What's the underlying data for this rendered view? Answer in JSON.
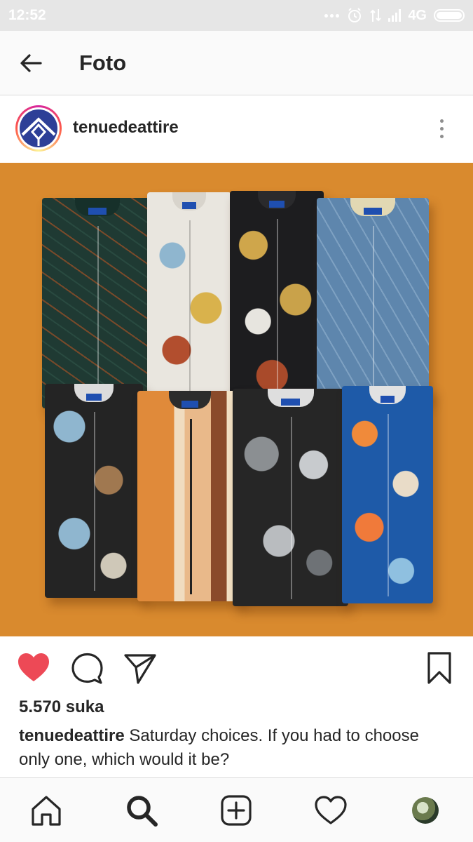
{
  "status_bar": {
    "time": "12:52",
    "network": "4G",
    "icons": [
      "notification-dots-icon",
      "alarm-icon",
      "data-arrows-icon",
      "signal-icon",
      "battery-icon"
    ]
  },
  "header": {
    "title": "Foto",
    "back_icon": "arrow-left-icon"
  },
  "post": {
    "username": "tenuedeattire",
    "more_icon": "more-vertical-icon",
    "photo": {
      "description_icon": "shirts-photo",
      "background_color": "#d98a2e"
    },
    "actions": {
      "liked": true,
      "like_color": "#ed4956",
      "icons": [
        "heart-icon",
        "comment-icon",
        "share-icon",
        "bookmark-icon"
      ]
    },
    "likes_text": "5.570 suka",
    "caption_user": "tenuedeattire",
    "caption_text": " Saturday choices. If you had to choose only one, which would it be?"
  },
  "bottom_nav": {
    "items": [
      "home-icon",
      "search-icon",
      "add-post-icon",
      "activity-heart-icon",
      "profile-avatar"
    ]
  }
}
